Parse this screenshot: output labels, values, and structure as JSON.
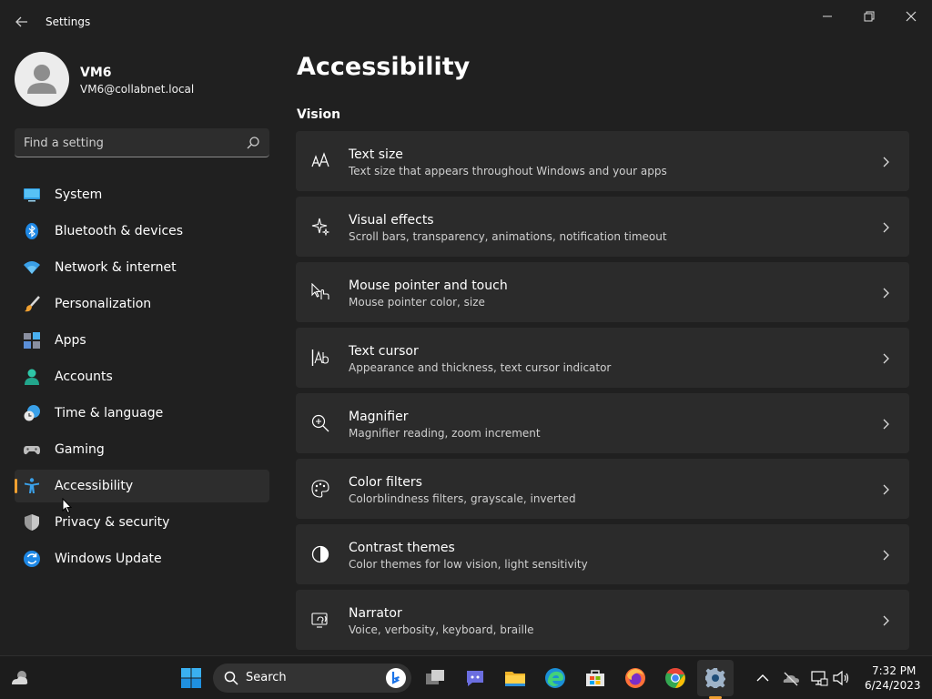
{
  "window": {
    "title": "Settings"
  },
  "profile": {
    "name": "VM6",
    "email": "VM6@collabnet.local"
  },
  "search": {
    "placeholder": "Find a setting"
  },
  "sidebar": {
    "items": [
      {
        "label": "System",
        "icon": "system-icon"
      },
      {
        "label": "Bluetooth & devices",
        "icon": "bluetooth-icon"
      },
      {
        "label": "Network & internet",
        "icon": "wifi-icon"
      },
      {
        "label": "Personalization",
        "icon": "brush-icon"
      },
      {
        "label": "Apps",
        "icon": "apps-icon"
      },
      {
        "label": "Accounts",
        "icon": "account-icon"
      },
      {
        "label": "Time & language",
        "icon": "clock-globe-icon"
      },
      {
        "label": "Gaming",
        "icon": "gamepad-icon"
      },
      {
        "label": "Accessibility",
        "icon": "accessibility-icon",
        "selected": true
      },
      {
        "label": "Privacy & security",
        "icon": "shield-icon"
      },
      {
        "label": "Windows Update",
        "icon": "update-icon"
      }
    ]
  },
  "main": {
    "title": "Accessibility",
    "section": "Vision",
    "cards": [
      {
        "title": "Text size",
        "desc": "Text size that appears throughout Windows and your apps",
        "icon": "text-size-icon"
      },
      {
        "title": "Visual effects",
        "desc": "Scroll bars, transparency, animations, notification timeout",
        "icon": "sparkle-icon"
      },
      {
        "title": "Mouse pointer and touch",
        "desc": "Mouse pointer color, size",
        "icon": "pointer-touch-icon"
      },
      {
        "title": "Text cursor",
        "desc": "Appearance and thickness, text cursor indicator",
        "icon": "text-cursor-icon"
      },
      {
        "title": "Magnifier",
        "desc": "Magnifier reading, zoom increment",
        "icon": "magnifier-icon"
      },
      {
        "title": "Color filters",
        "desc": "Colorblindness filters, grayscale, inverted",
        "icon": "palette-icon"
      },
      {
        "title": "Contrast themes",
        "desc": "Color themes for low vision, light sensitivity",
        "icon": "contrast-icon"
      },
      {
        "title": "Narrator",
        "desc": "Voice, verbosity, keyboard, braille",
        "icon": "narrator-icon"
      }
    ]
  },
  "taskbar": {
    "search_label": "Search",
    "time": "7:32 PM",
    "date": "6/24/2023"
  },
  "colors": {
    "accent": "#f0a030",
    "background": "#202020",
    "card": "#2b2b2b"
  }
}
